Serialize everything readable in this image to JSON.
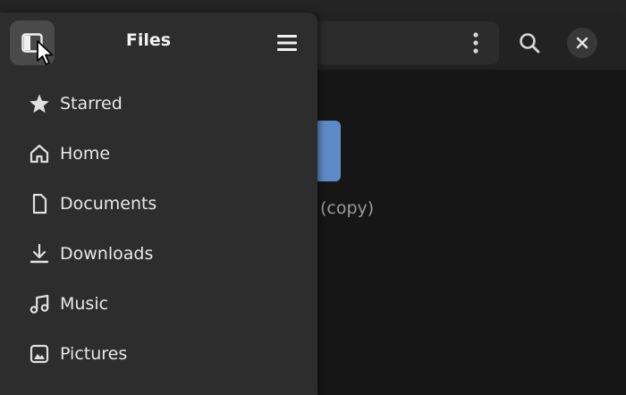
{
  "app": {
    "title": "Files"
  },
  "main": {
    "folder_label": "(copy)",
    "path_menu_icon": "vertical-dots-icon",
    "search_icon": "search-icon",
    "close_icon": "close-icon"
  },
  "sidebar": {
    "title": "Files",
    "toggle_icon": "sidebar-toggle-icon",
    "menu_icon": "hamburger-menu-icon",
    "items": [
      {
        "label": "Starred",
        "icon": "star-icon"
      },
      {
        "label": "Home",
        "icon": "home-icon"
      },
      {
        "label": "Documents",
        "icon": "document-icon"
      },
      {
        "label": "Downloads",
        "icon": "download-icon"
      },
      {
        "label": "Music",
        "icon": "music-icon"
      },
      {
        "label": "Pictures",
        "icon": "picture-icon"
      }
    ]
  },
  "colors": {
    "sidebar_bg": "#2d2d2d",
    "content_bg": "#161616",
    "header_bg": "#222222",
    "folder_accent": "#5d8bc7",
    "text_primary": "#e8e8e8",
    "text_muted": "#9a9a9a"
  }
}
